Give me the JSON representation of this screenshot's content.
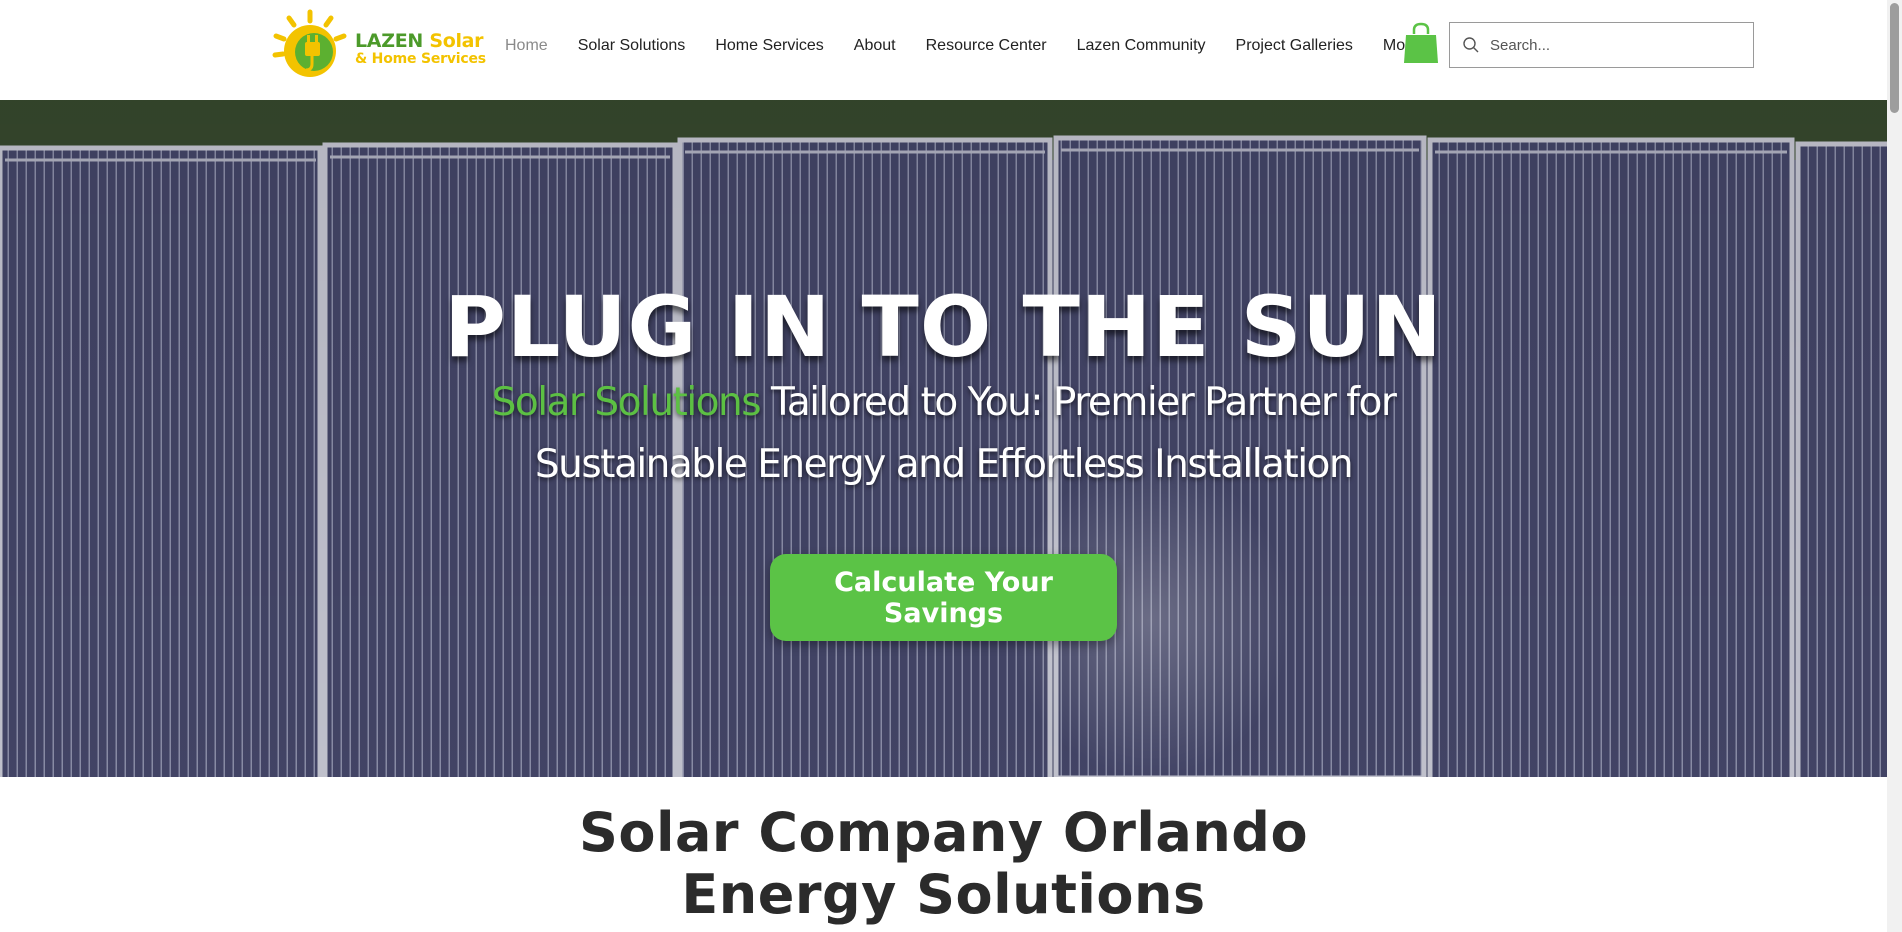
{
  "header": {
    "logo": {
      "word1": "LAZEN",
      "word2": "Solar",
      "tagline": "& Home Services"
    },
    "nav": [
      {
        "label": "Home",
        "active": true
      },
      {
        "label": "Solar Solutions",
        "active": false
      },
      {
        "label": "Home Services",
        "active": false
      },
      {
        "label": "About",
        "active": false
      },
      {
        "label": "Resource Center",
        "active": false
      },
      {
        "label": "Lazen Community",
        "active": false
      },
      {
        "label": "Project Galleries",
        "active": false
      },
      {
        "label": "More",
        "active": false
      }
    ],
    "cart_icon": "shopping-bag-icon",
    "search": {
      "placeholder": "Search...",
      "value": ""
    }
  },
  "hero": {
    "title": "PLUG IN TO THE SUN",
    "subtitle_accent": "Solar Solutions",
    "subtitle_line1_rest": " Tailored to You: Premier Partner for",
    "subtitle_line2": "Sustainable Energy and Effortless Installation",
    "cta_label": "Calculate Your Savings"
  },
  "section": {
    "title_line1": "Solar Company Orlando",
    "title_line2": "Energy Solutions"
  },
  "colors": {
    "brand_green": "#5bc346",
    "logo_yellow": "#f3c300",
    "panel_purple": "#434567",
    "nav_text": "#222222",
    "nav_active": "#8a8a8a"
  }
}
